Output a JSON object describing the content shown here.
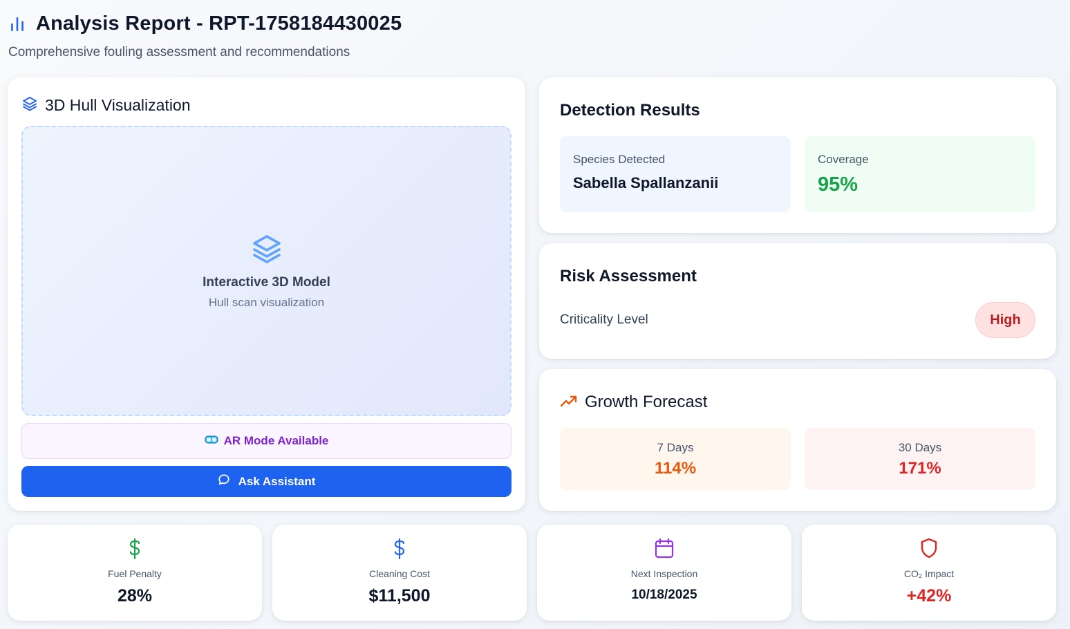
{
  "header": {
    "title": "Analysis Report - RPT-1758184430025",
    "subtitle": "Comprehensive fouling assessment and recommendations",
    "icon": "bar-chart-icon"
  },
  "hull": {
    "title": "3D Hull Visualization",
    "model_label": "Interactive 3D Model",
    "model_sub": "Hull scan visualization",
    "ar_label": "AR Mode Available",
    "ask_label": "Ask Assistant"
  },
  "detection": {
    "title": "Detection Results",
    "species_label": "Species Detected",
    "species_value": "Sabella Spallanzanii",
    "coverage_label": "Coverage",
    "coverage_value": "95%"
  },
  "risk": {
    "title": "Risk Assessment",
    "criticality_label": "Criticality Level",
    "criticality_value": "High"
  },
  "growth": {
    "title": "Growth Forecast",
    "d7_label": "7 Days",
    "d7_value": "114%",
    "d30_label": "30 Days",
    "d30_value": "171%"
  },
  "stats": {
    "fuel_label": "Fuel Penalty",
    "fuel_value": "28%",
    "cleaning_label": "Cleaning Cost",
    "cleaning_value": "$11,500",
    "inspection_label": "Next Inspection",
    "inspection_value": "10/18/2025",
    "co2_label": "CO₂ Impact",
    "co2_value": "+42%"
  },
  "colors": {
    "primary": "#1e63f0",
    "success": "#16a34a",
    "danger": "#dc2626",
    "warning": "#ea580c",
    "purple": "#7e22ce"
  }
}
